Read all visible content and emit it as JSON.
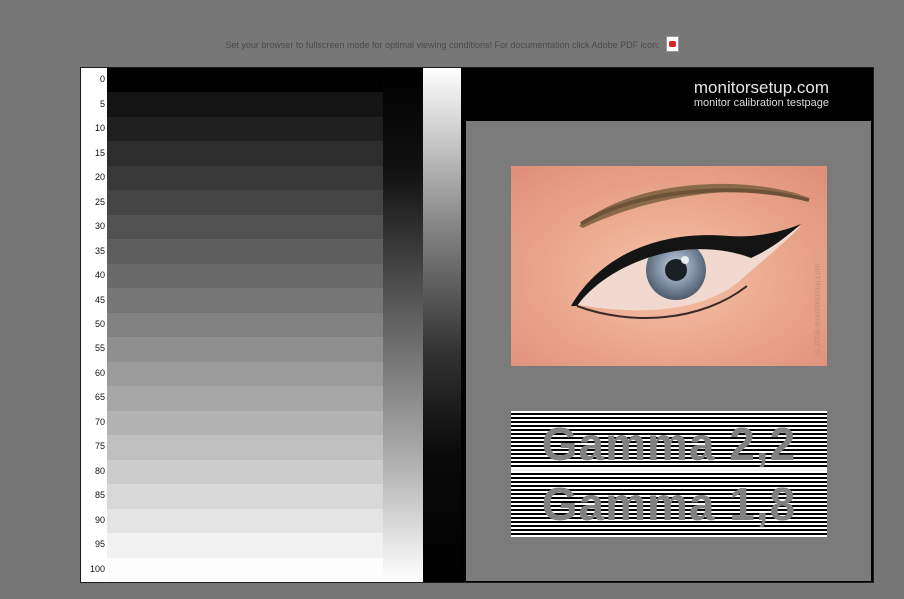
{
  "notice": {
    "text": "Set your browser to fullscreen mode for optimal viewing conditions! For documentation click Adobe PDF icon:",
    "pdf_icon": "pdf-icon"
  },
  "header": {
    "title": "monitorsetup.com",
    "subtitle": "monitor calibration testpage"
  },
  "scale_labels": [
    "0",
    "5",
    "10",
    "15",
    "20",
    "25",
    "30",
    "35",
    "40",
    "45",
    "50",
    "55",
    "60",
    "65",
    "70",
    "75",
    "80",
    "85",
    "90",
    "95",
    "100"
  ],
  "gamma": {
    "line1": "Gamma 2,2",
    "line2": "Gamma 1,8"
  },
  "eye_image": {
    "watermark": "©2006 monitorsetup.com"
  }
}
